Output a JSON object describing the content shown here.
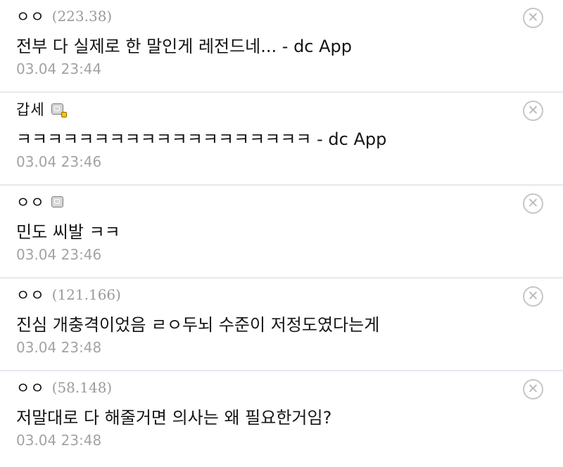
{
  "comments": [
    {
      "nick": "ㅇㅇ",
      "ip": "(223.38)",
      "text": "전부 다 실제로 한 말인게 레전드네... - dc App",
      "date": "03.04 23:44"
    },
    {
      "nick": "갑세",
      "text": "ㅋㅋㅋㅋㅋㅋㅋㅋㅋㅋㅋㅋㅋㅋㅋㅋㅋㅋㅋ - dc App",
      "date": "03.04 23:46",
      "icon": "gallog-fixed-nick-icon"
    },
    {
      "nick": "ㅇㅇ",
      "text": "민도 씨발 ㅋㅋ",
      "date": "03.04 23:46",
      "icon": "gallog-icon"
    },
    {
      "nick": "ㅇㅇ",
      "ip": "(121.166)",
      "text": "진심 개충격이었음 ㄹㅇ두뇌 수준이 저정도였다는게",
      "date": "03.04 23:48"
    },
    {
      "nick": "ㅇㅇ",
      "ip": "(58.148)",
      "text": "저말대로 다 해줄거면 의사는 왜 필요한거임?",
      "date": "03.04 23:48"
    }
  ],
  "delete_icon": "close-circle-icon",
  "colors": {
    "divider": "#e7e7ee",
    "date": "#a3a3a3",
    "ip": "#9a9a9a"
  }
}
